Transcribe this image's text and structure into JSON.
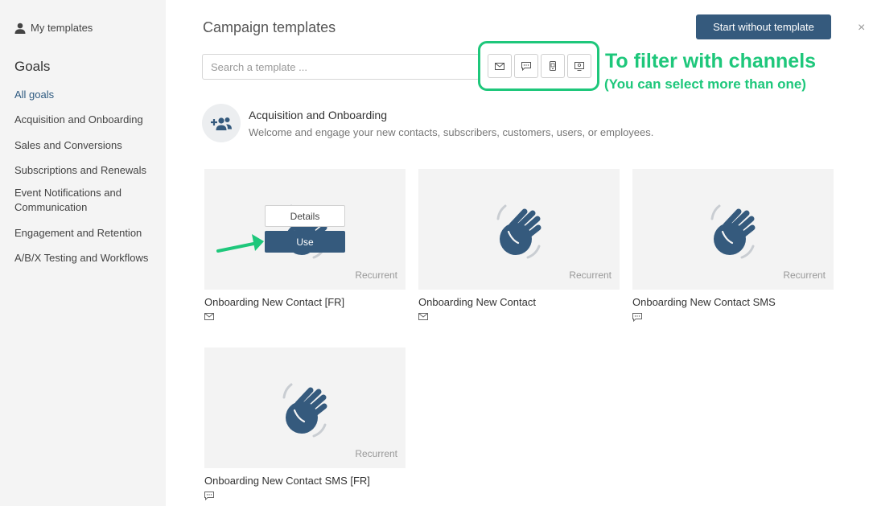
{
  "sidebar": {
    "my_templates": "My templates",
    "goals_title": "Goals",
    "goals": [
      "All goals",
      "Acquisition and Onboarding",
      "Sales and Conversions",
      "Subscriptions and Renewals",
      "Event Notifications and Communication",
      "Engagement and Retention",
      "A/B/X Testing and Workflows"
    ]
  },
  "header": {
    "title": "Campaign templates",
    "start_button": "Start without template",
    "close": "×"
  },
  "search": {
    "placeholder": "Search a template ..."
  },
  "channels": [
    "email-icon",
    "sms-icon",
    "mobile-icon",
    "web-push-icon"
  ],
  "annotation": {
    "main": "To filter with channels",
    "sub": "(You can select more than one)"
  },
  "category": {
    "title": "Acquisition and Onboarding",
    "description": "Welcome and engage your new contacts, subscribers, customers, users, or employees."
  },
  "overlay": {
    "details": "Details",
    "use": "Use"
  },
  "templates": [
    {
      "name": "Onboarding New Contact [FR]",
      "tag": "Recurrent",
      "channel": "email-icon"
    },
    {
      "name": "Onboarding New Contact",
      "tag": "Recurrent",
      "channel": "email-icon"
    },
    {
      "name": "Onboarding New Contact SMS",
      "tag": "Recurrent",
      "channel": "sms-icon"
    },
    {
      "name": "Onboarding New Contact SMS [FR]",
      "tag": "Recurrent",
      "channel": "sms-icon"
    }
  ],
  "colors": {
    "primary": "#355a7d",
    "annotation": "#1ec77b",
    "sidebar_bg": "#f4f4f4"
  }
}
